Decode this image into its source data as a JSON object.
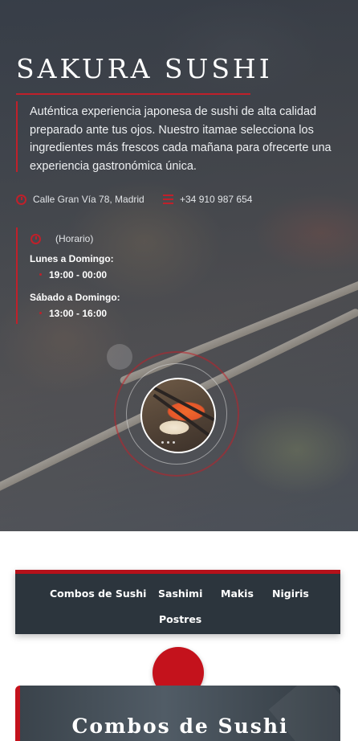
{
  "hero": {
    "title": "SAKURA SUSHI",
    "description": "Auténtica experiencia japonesa de sushi de alta calidad preparado ante tus ojos. Nuestro itamae selecciona los ingredientes más frescos cada mañana para ofrecerte una experiencia gastronómica única.",
    "address": "Calle Gran Vía 78, Madrid",
    "phone": "+34 910 987 654",
    "address_icon": "location-icon",
    "phone_icon": "phone-icon"
  },
  "hours": {
    "label": "(Horario)",
    "icon": "clock-icon",
    "entries": [
      {
        "day": "Lunes a Domingo:",
        "time": "19:00 - 00:00"
      },
      {
        "day": "Sábado a Domingo:",
        "time": "13:00 - 16:00"
      }
    ]
  },
  "nav": {
    "items": [
      {
        "label": "Combos de Sushi"
      },
      {
        "label": "Sashimi"
      },
      {
        "label": "Makis"
      },
      {
        "label": "Nigiris"
      },
      {
        "label": "Postres"
      }
    ]
  },
  "section": {
    "title": "Combos de Sushi"
  },
  "colors": {
    "accent": "#c0202a",
    "nav_bg": "#2c353d",
    "nav_border": "#b5111a"
  }
}
